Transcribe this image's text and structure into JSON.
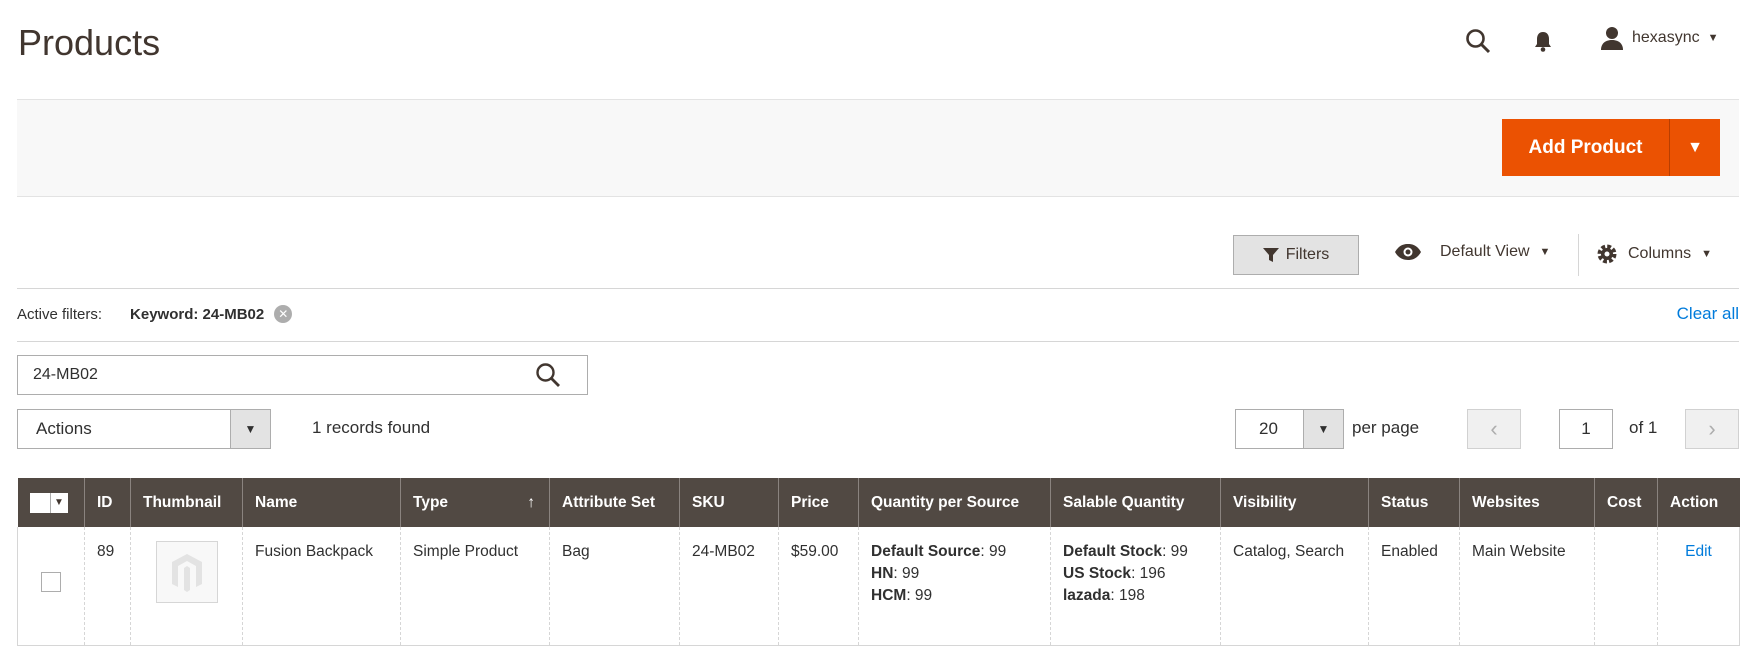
{
  "header": {
    "title": "Products",
    "user": "hexasync",
    "icons": [
      "search-icon",
      "bell-icon",
      "user-icon"
    ]
  },
  "actions_bar": {
    "add_product": "Add Product"
  },
  "toolbar": {
    "filters": "Filters",
    "view": "Default View",
    "columns": "Columns"
  },
  "active_filters": {
    "label": "Active filters:",
    "keyword": "Keyword: 24-MB02",
    "clear_all": "Clear all"
  },
  "search": {
    "value": "24-MB02"
  },
  "mass_actions": {
    "label": "Actions",
    "records": "1 records found"
  },
  "pagination": {
    "per_page": "20",
    "per_page_label": "per page",
    "page": "1",
    "of": "of 1"
  },
  "colors": {
    "accent": "#eb5202",
    "header_bg": "#514943",
    "link": "#007bdb"
  },
  "table": {
    "columns": [
      "ID",
      "Thumbnail",
      "Name",
      "Type",
      "Attribute Set",
      "SKU",
      "Price",
      "Quantity per Source",
      "Salable Quantity",
      "Visibility",
      "Status",
      "Websites",
      "Cost",
      "Action"
    ],
    "sort_indicator": "↑",
    "rows": [
      {
        "id": "89",
        "name": "Fusion Backpack",
        "type": "Simple Product",
        "attribute_set": "Bag",
        "sku": "24-MB02",
        "price": "$59.00",
        "qty_per_source": [
          {
            "k": "Default Source",
            "v": ": 99"
          },
          {
            "k": "HN",
            "v": ": 99"
          },
          {
            "k": "HCM",
            "v": ": 99"
          }
        ],
        "salable": [
          {
            "k": "Default Stock",
            "v": ": 99"
          },
          {
            "k": "US Stock",
            "v": ": 196"
          },
          {
            "k": "lazada",
            "v": ": 198"
          }
        ],
        "visibility": "Catalog, Search",
        "status": "Enabled",
        "websites": "Main Website",
        "cost": "",
        "action": "Edit"
      }
    ]
  }
}
